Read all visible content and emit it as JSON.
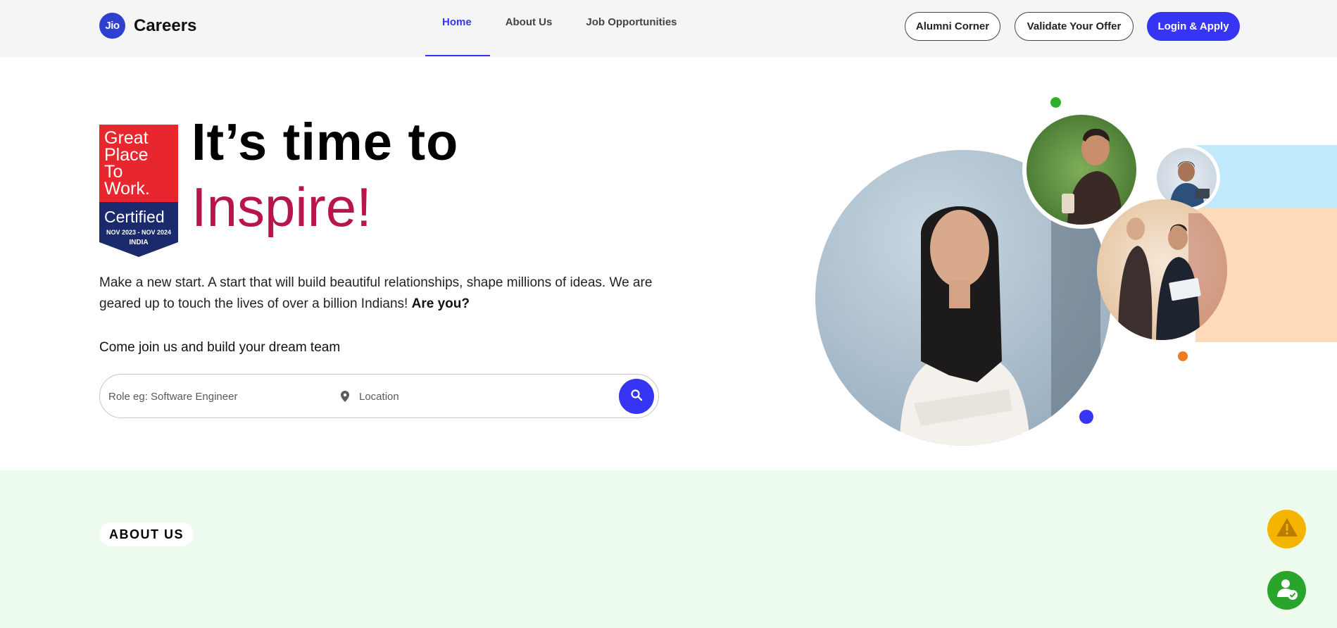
{
  "header": {
    "logo_mark": "Jio",
    "logo_text": "Careers",
    "nav": [
      {
        "label": "Home",
        "active": true
      },
      {
        "label": "About Us",
        "active": false
      },
      {
        "label": "Job Opportunities",
        "active": false
      }
    ],
    "buttons": {
      "alumni": "Alumni Corner",
      "validate": "Validate Your Offer",
      "login": "Login & Apply"
    }
  },
  "badge": {
    "line1": "Great",
    "line2": "Place",
    "line3": "To",
    "line4": "Work.",
    "certified": "Certified",
    "period": "NOV 2023 - NOV 2024",
    "country": "INDIA"
  },
  "hero": {
    "title_line1": "It’s time to",
    "title_line2": "Inspire!",
    "description": "Make a new start. A start that will build beautiful relationships, shape millions of ideas. We are geared up to touch the lives of over a billion Indians!",
    "description_bold": "Are you?",
    "join_text": "Come join us and build your dream team"
  },
  "search": {
    "role_placeholder": "Role eg: Software Engineer",
    "location_placeholder": "Location"
  },
  "about": {
    "pill": "ABOUT US"
  },
  "colors": {
    "accent": "#3535f3",
    "inspire": "#b8154f",
    "badge_red": "#e8262d",
    "badge_navy": "#1b2a6d",
    "about_bg": "#edfbee",
    "warning_fab": "#f5b400",
    "success_fab": "#2aa52c"
  },
  "icons": [
    "location-pin-icon",
    "search-icon",
    "warning-icon",
    "person-check-icon"
  ]
}
